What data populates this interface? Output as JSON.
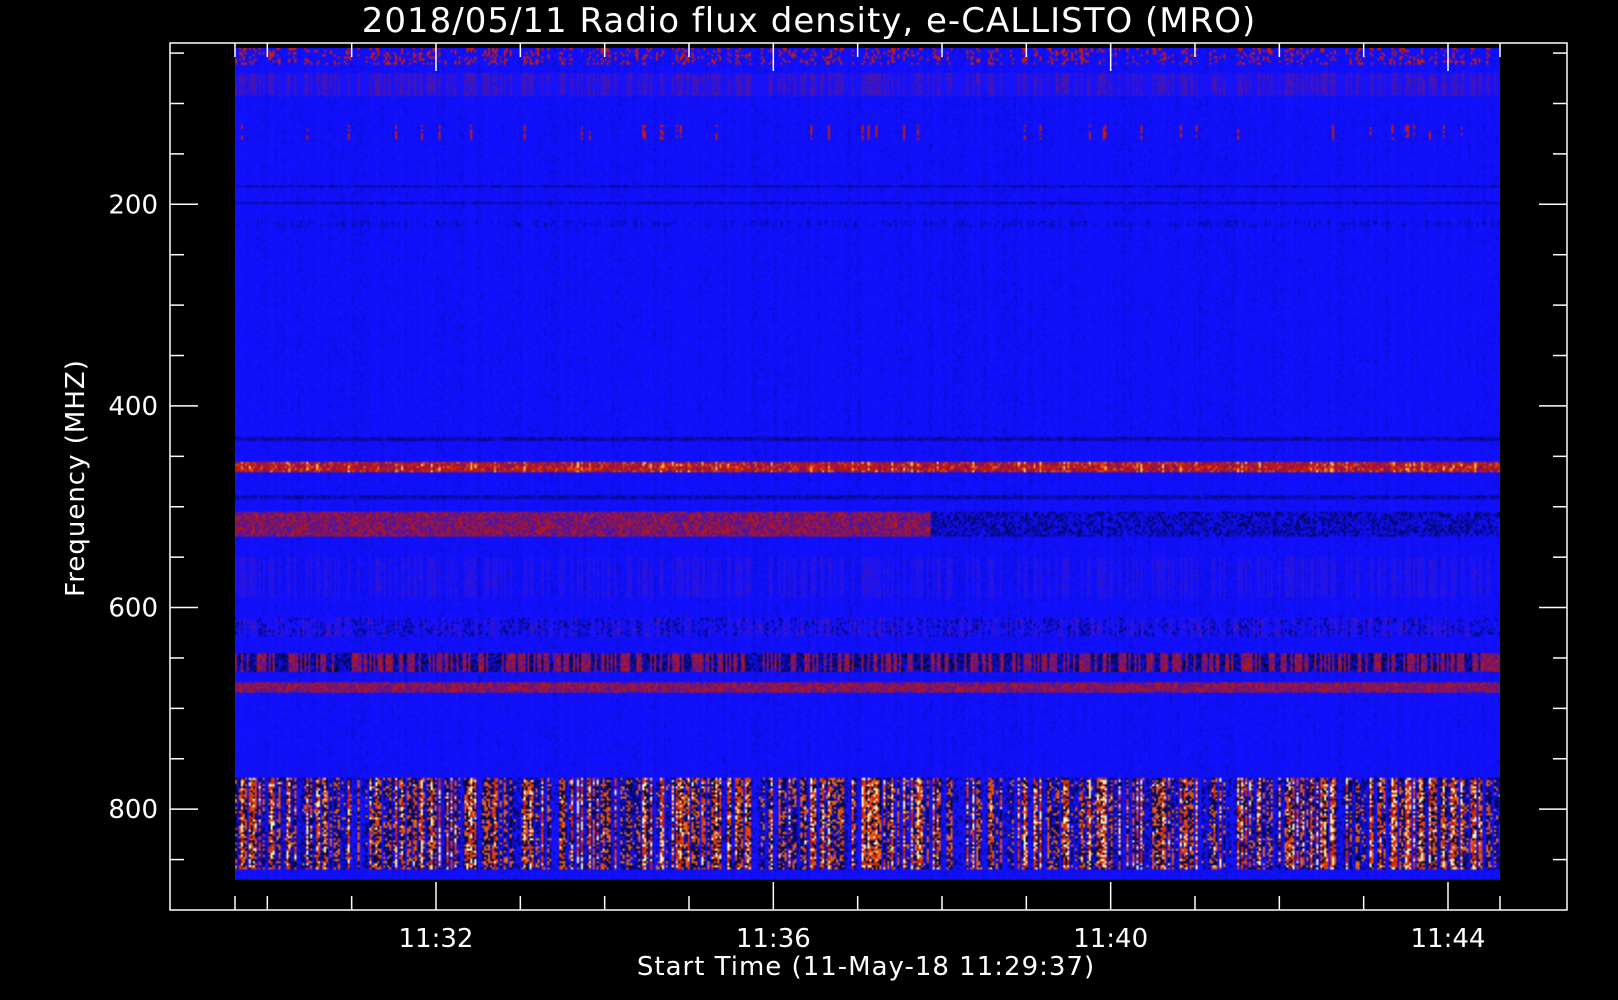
{
  "chart_data": {
    "type": "heatmap",
    "title": "2018/05/11  Radio flux density, e-CALLISTO (MRO)",
    "xlabel": "Start Time (11-May-18 11:29:37)",
    "ylabel": "Frequency (MHZ)",
    "x_range": [
      "11:29:37",
      "11:44:37"
    ],
    "x_tick_labels": [
      "11:32",
      "11:36",
      "11:40",
      "11:44"
    ],
    "x_major_ticks_seconds": [
      143,
      383,
      623,
      863
    ],
    "ylim": [
      900,
      40
    ],
    "y_major_ticks": [
      200,
      400,
      600,
      800
    ],
    "y_minor_ticks": [
      50,
      100,
      150,
      250,
      300,
      350,
      450,
      500,
      550,
      650,
      700,
      750,
      850
    ],
    "freq_range_mhz": [
      45,
      870
    ],
    "colormap": [
      "#000000",
      "#1010ff",
      "#cc1a00",
      "#ffd040",
      "#ffffcc"
    ],
    "background_level": "blue",
    "bands": [
      {
        "freq_from": 45,
        "freq_to": 60,
        "level": "red-speckled"
      },
      {
        "freq_from": 68,
        "freq_to": 92,
        "level": "faint-red"
      },
      {
        "freq_from": 120,
        "freq_to": 135,
        "level": "sparse-red-spots"
      },
      {
        "freq_from": 180,
        "freq_to": 182,
        "level": "dark-line"
      },
      {
        "freq_from": 197,
        "freq_to": 199,
        "level": "dark-line"
      },
      {
        "freq_from": 215,
        "freq_to": 222,
        "level": "dark"
      },
      {
        "freq_from": 430,
        "freq_to": 434,
        "level": "dark-line"
      },
      {
        "freq_from": 455,
        "freq_to": 465,
        "level": "bright-red"
      },
      {
        "freq_from": 488,
        "freq_to": 492,
        "level": "dark-line"
      },
      {
        "freq_from": 505,
        "freq_to": 530,
        "level": "red-to-dark"
      },
      {
        "freq_from": 550,
        "freq_to": 590,
        "level": "faint-red-stripes"
      },
      {
        "freq_from": 610,
        "freq_to": 630,
        "level": "dark-mottled"
      },
      {
        "freq_from": 645,
        "freq_to": 665,
        "level": "dark-and-red"
      },
      {
        "freq_from": 675,
        "freq_to": 685,
        "level": "red-band"
      },
      {
        "freq_from": 770,
        "freq_to": 860,
        "level": "intense-yellow-red"
      }
    ]
  }
}
